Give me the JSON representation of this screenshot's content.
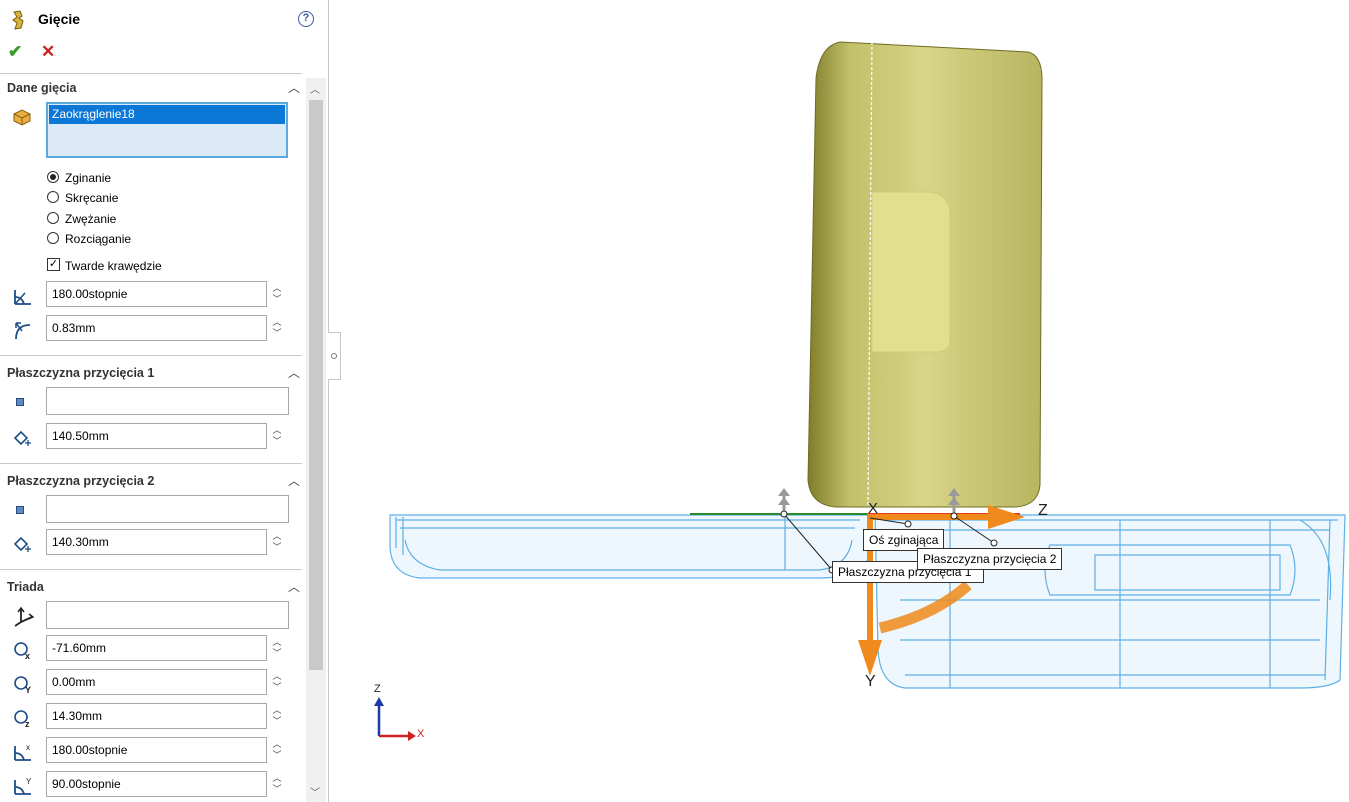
{
  "panel": {
    "title": "Gięcie",
    "help_icon": "?",
    "ok_icon": "✔",
    "cancel_icon": "✕",
    "icons": [
      "flex-feature-icon",
      "help-icon",
      "ok-icon",
      "cancel-icon"
    ]
  },
  "bend_data": {
    "title": "Dane gięcia",
    "selected_body": "Zaokrąglenie18",
    "options": [
      "Zginanie",
      "Skręcanie",
      "Zwężanie",
      "Rozciąganie"
    ],
    "selected_option": "Zginanie",
    "hard_edges_label": "Twarde krawędzie",
    "hard_edges_checked": true,
    "angle": "180.00stopnie",
    "radius": "0.83mm"
  },
  "trim_plane_1": {
    "title": "Płaszczyzna przycięcia 1",
    "reference": "",
    "distance": "140.50mm"
  },
  "trim_plane_2": {
    "title": "Płaszczyzna przycięcia 2",
    "reference": "",
    "distance": "140.30mm"
  },
  "triad": {
    "title": "Triada",
    "reference": "",
    "x": "-71.60mm",
    "y": "0.00mm",
    "z": "14.30mm",
    "rot_x": "180.00stopnie",
    "rot_y": "90.00stopnie"
  },
  "viewport": {
    "callouts": {
      "bend_axis": "Oś zginająca",
      "trim_plane_1": "Płaszczyzna przycięcia 1",
      "trim_plane_2": "Płaszczyzna przycięcia 2"
    },
    "triad_axes": {
      "y": "Y",
      "z": "Z",
      "x": "X"
    },
    "orientation": {
      "z": "Z",
      "x": "X"
    },
    "colors": {
      "body": "#c9c776",
      "wireframe": "#5fb0e6",
      "arrow": "#f08a1c"
    }
  }
}
